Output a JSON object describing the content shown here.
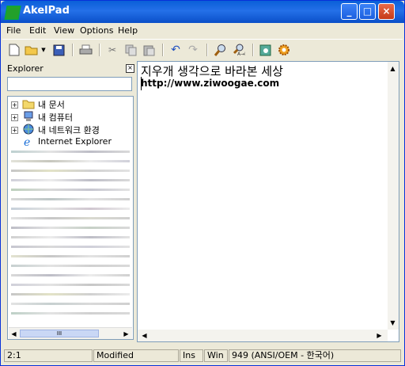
{
  "window": {
    "title": "AkelPad"
  },
  "menu": [
    "File",
    "Edit",
    "View",
    "Options",
    "Help"
  ],
  "toolbar": {
    "icons": [
      "new-icon",
      "open-icon",
      "dropdown-icon",
      "save-icon",
      "print-icon",
      "cut-icon",
      "copy-icon",
      "paste-icon",
      "undo-icon",
      "redo-icon",
      "find-icon",
      "replace-icon",
      "plugin-icon",
      "settings-icon"
    ]
  },
  "explorer": {
    "label": "Explorer",
    "items": [
      {
        "label": "내 문서",
        "expandable": "+"
      },
      {
        "label": "내 컴퓨터",
        "expandable": "+"
      },
      {
        "label": "내 네트워크 환경",
        "expandable": "+"
      },
      {
        "label": "Internet Explorer",
        "expandable": ""
      }
    ],
    "scroll_thumb": "III"
  },
  "editor": {
    "lines": [
      "지우개 생각으로 바라본 세상",
      "http://www.ziwoogae.com"
    ]
  },
  "status": {
    "position": "2:1",
    "modified": "Modified",
    "insert_mode": "Ins",
    "newline": "Win",
    "encoding": "949  (ANSI/OEM - 한국어)"
  },
  "colors": {
    "titlebar": "#0a5fd8",
    "accent_green": "#23a02a"
  }
}
